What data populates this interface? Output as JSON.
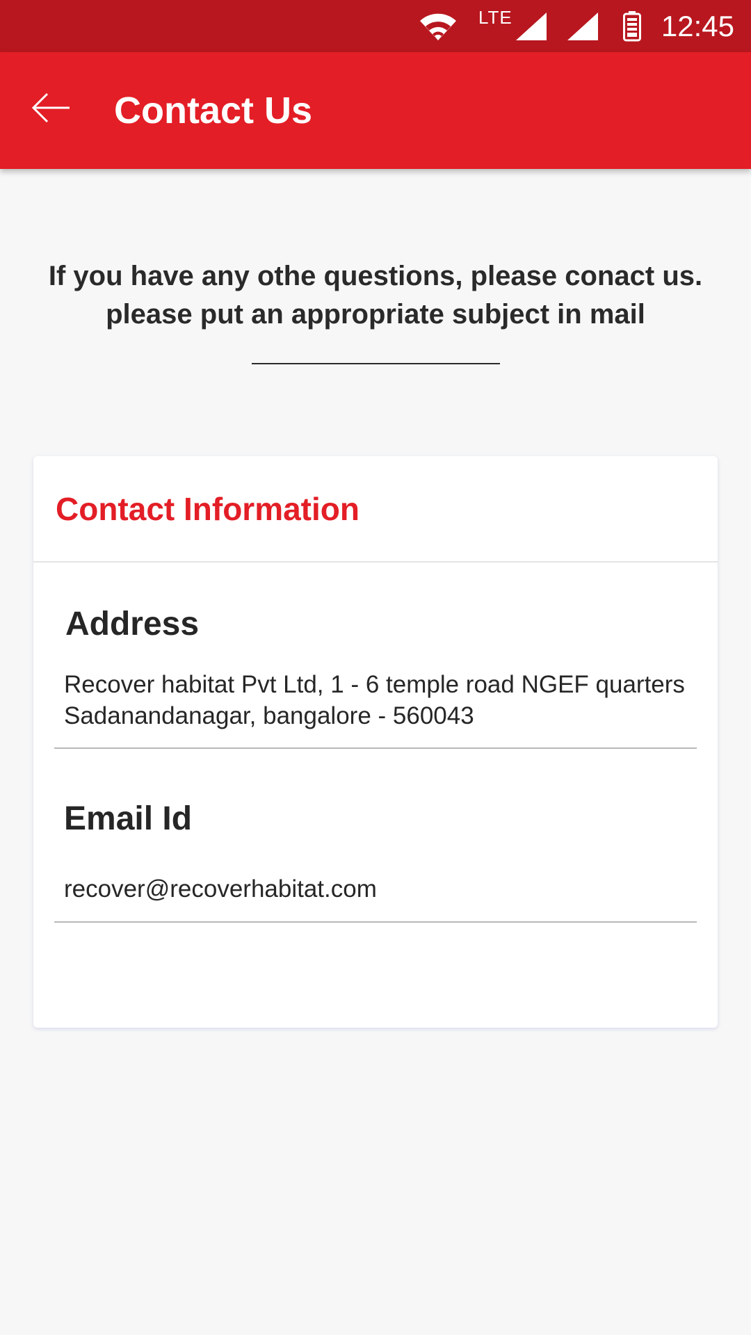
{
  "status_bar": {
    "network_label": "LTE",
    "time": "12:45",
    "icons": [
      "wifi-icon",
      "signal-icon",
      "signal-icon",
      "battery-icon"
    ]
  },
  "app_bar": {
    "title": "Contact Us",
    "back_icon": "arrow-left-icon",
    "color": "#e31e26"
  },
  "intro": {
    "line1": "If you have any othe questions, please conact us.",
    "line2": "please put an appropriate subject in mail"
  },
  "contact_card": {
    "header": "Contact Information",
    "address": {
      "label": "Address",
      "line1": "Recover habitat Pvt Ltd, 1 - 6 temple road NGEF quarters",
      "line2": "Sadanandanagar, bangalore - 560043"
    },
    "email": {
      "label": "Email Id",
      "value": "recover@recoverhabitat.com"
    }
  },
  "colors": {
    "status_bar": "#b8171f",
    "accent": "#e31e26",
    "background": "#f7f7f7"
  }
}
